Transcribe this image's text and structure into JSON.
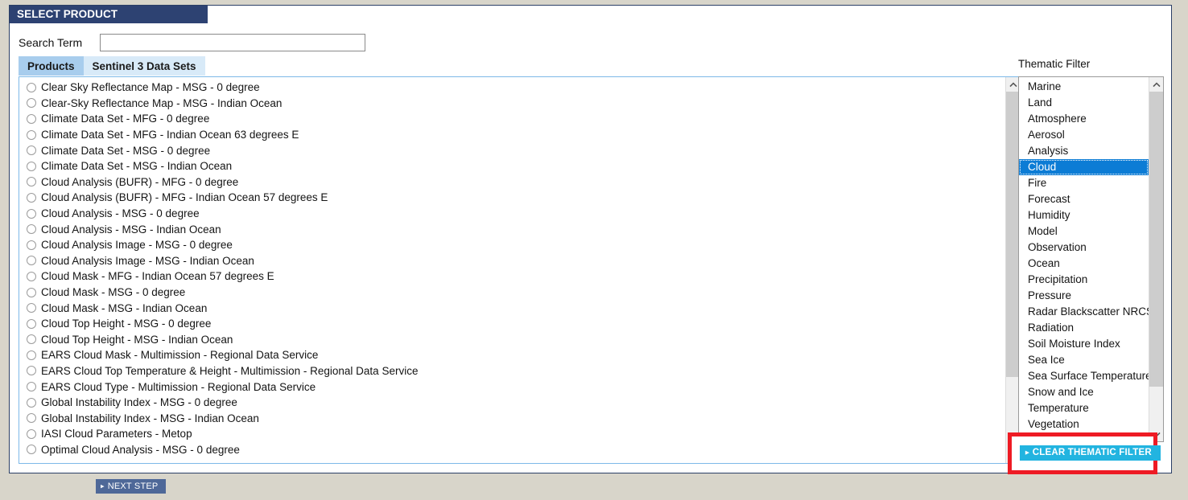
{
  "window": {
    "title": "SELECT PRODUCT",
    "colors": {
      "titlebar_bg": "#2d4272",
      "page_bg": "#d8d5ca",
      "panel_border": "#2b3f66",
      "list_border": "#7db9e8",
      "tab_active_bg": "#a8cded",
      "tab_inactive_bg": "#d8eaf8",
      "selection_blue": "#0c7cd5",
      "clear_button_bg": "#22b4e0",
      "next_button_bg": "#4e6898",
      "callout_red": "#ee1b24"
    }
  },
  "search": {
    "label": "Search Term",
    "value": "",
    "placeholder": ""
  },
  "tabs": [
    {
      "label": "Products",
      "active": true
    },
    {
      "label": "Sentinel 3 Data Sets",
      "active": false
    }
  ],
  "products": {
    "selected": null,
    "items": [
      "Clear Sky Reflectance Map - MSG - 0 degree",
      "Clear-Sky Reflectance Map - MSG - Indian Ocean",
      "Climate Data Set - MFG - 0 degree",
      "Climate Data Set - MFG - Indian Ocean 63 degrees E",
      "Climate Data Set - MSG - 0 degree",
      "Climate Data Set - MSG - Indian Ocean",
      "Cloud Analysis (BUFR) - MFG - 0 degree",
      "Cloud Analysis (BUFR) - MFG - Indian Ocean 57 degrees E",
      "Cloud Analysis - MSG - 0 degree",
      "Cloud Analysis - MSG - Indian Ocean",
      "Cloud Analysis Image - MSG - 0 degree",
      "Cloud Analysis Image - MSG - Indian Ocean",
      "Cloud Mask - MFG - Indian Ocean 57 degrees E",
      "Cloud Mask - MSG - 0 degree",
      "Cloud Mask - MSG - Indian Ocean",
      "Cloud Top Height - MSG - 0 degree",
      "Cloud Top Height - MSG - Indian Ocean",
      "EARS Cloud Mask - Multimission - Regional Data Service",
      "EARS Cloud Top Temperature & Height - Multimission - Regional Data Service",
      "EARS Cloud Type - Multimission - Regional Data Service",
      "Global Instability Index - MSG - 0 degree",
      "Global Instability Index - MSG - Indian Ocean",
      "IASI Cloud Parameters - Metop",
      "Optimal Cloud Analysis - MSG - 0 degree"
    ]
  },
  "thematic_filter": {
    "label": "Thematic Filter",
    "selected": "Cloud",
    "items": [
      "Marine",
      "Land",
      "Atmosphere",
      "Aerosol",
      "Analysis",
      "Cloud",
      "Fire",
      "Forecast",
      "Humidity",
      "Model",
      "Observation",
      "Ocean",
      "Precipitation",
      "Pressure",
      "Radar Blackscatter NRCS",
      "Radiation",
      "Soil Moisture Index",
      "Sea Ice",
      "Sea Surface Temperature",
      "Snow and Ice",
      "Temperature",
      "Vegetation"
    ]
  },
  "buttons": {
    "clear_thematic_filter": "CLEAR THEMATIC FILTER",
    "next_step": "NEXT STEP",
    "triangle_glyph": "▸"
  },
  "scrollbars": {
    "products": {
      "thumb_top_pct": 0,
      "thumb_height_pct": 80
    },
    "thematic": {
      "thumb_top_pct": 0,
      "thumb_height_pct": 88
    }
  }
}
